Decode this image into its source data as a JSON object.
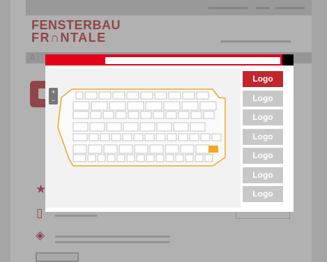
{
  "brand": {
    "line1": "FENSTERBAU",
    "line2": "FR∩NTALE"
  },
  "nav": {
    "home_icon": "home-icon"
  },
  "modal": {
    "map_icon": "floor-plan",
    "zoom_in": "+",
    "zoom_out": "−",
    "logos": [
      {
        "label": "Logo",
        "active": true
      },
      {
        "label": "Logo",
        "active": false
      },
      {
        "label": "Logo",
        "active": false
      },
      {
        "label": "Logo",
        "active": false
      },
      {
        "label": "Logo",
        "active": false
      },
      {
        "label": "Logo",
        "active": false
      },
      {
        "label": "Logo",
        "active": false
      }
    ]
  },
  "icons": {
    "home": "⌂",
    "star": "★",
    "phone": "▯",
    "ticket": "◈"
  },
  "colors": {
    "accent": "#c0272d",
    "header": "#e2001a",
    "booth_outline": "#f5a623"
  }
}
